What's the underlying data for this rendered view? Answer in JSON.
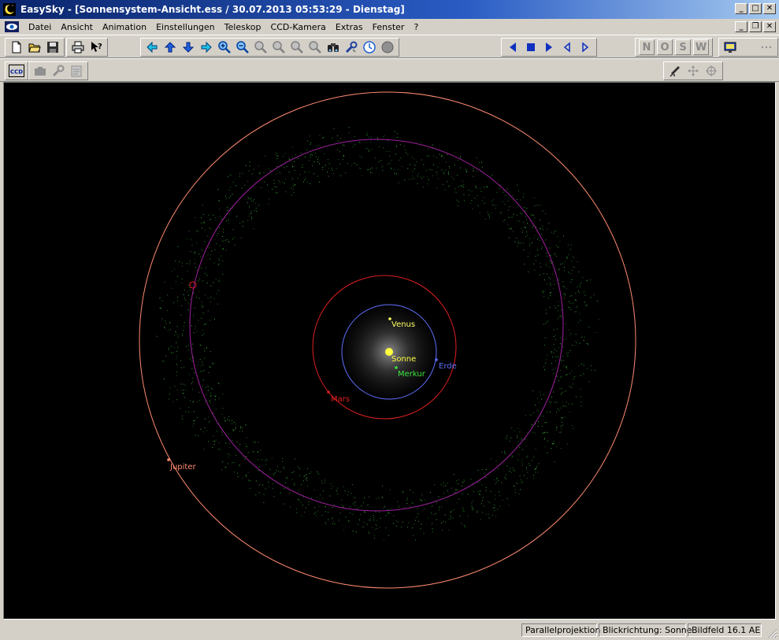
{
  "window": {
    "title": "EasySky - [Sonnensystem-Ansicht.ess / 30.07.2013 05:53:29 - Dienstag]"
  },
  "menu": {
    "items": [
      "Datei",
      "Ansicht",
      "Animation",
      "Einstellungen",
      "Teleskop",
      "CCD-Kamera",
      "Extras",
      "Fenster",
      "?"
    ]
  },
  "toolbar": {
    "direction_buttons": [
      "N",
      "O",
      "S",
      "W"
    ],
    "ccd_label": "CCD"
  },
  "planets": {
    "venus": "Venus",
    "sonne": "Sonne",
    "erde": "Erde",
    "merkur": "Merkur",
    "mars": "Mars",
    "jupiter": "Jupiter"
  },
  "colors": {
    "sun": "#ffff40",
    "mercury": "#3ce43c",
    "venus": "#ffff60",
    "earth": "#6070ff",
    "mars": "#e02020",
    "jupiter": "#ff8a70",
    "outer_orbit": "#ff8a70",
    "asteroid_orbit": "#a020a0",
    "asteroids": "#40c040"
  },
  "status": {
    "projection": "Parallelprojektion",
    "view_direction": "Blickrichtung: Sonne",
    "field": "Bildfeld 16.1 AE"
  }
}
